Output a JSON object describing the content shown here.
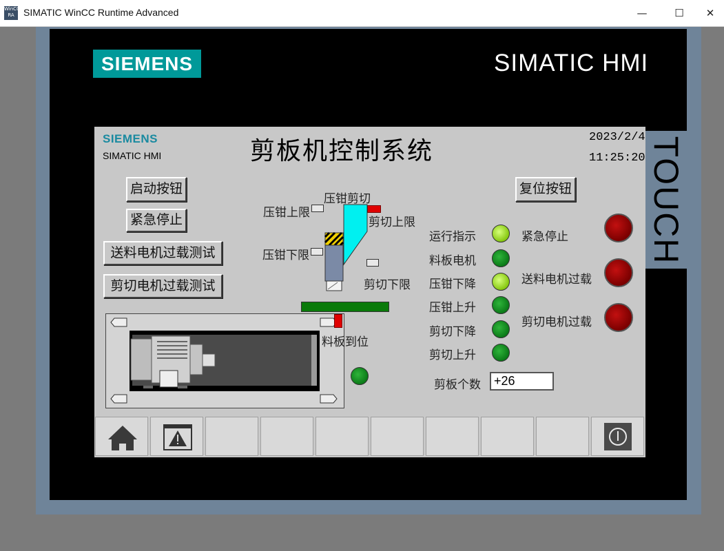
{
  "window": {
    "title": "SIMATIC WinCC Runtime Advanced",
    "icon_text_top": "WinCC",
    "icon_text_bottom": "RA",
    "minimize": "—",
    "maximize": "☐",
    "close": "✕"
  },
  "device": {
    "brand_logo": "SIEMENS",
    "brand_product": "SIMATIC HMI",
    "touch_label": "TOUCH"
  },
  "screen": {
    "logo": "SIEMENS",
    "product": "SIMATIC HMI",
    "title": "剪板机控制系统",
    "date": "2023/2/4",
    "time": "11:25:20",
    "buttons": {
      "start": "启动按钮",
      "estop": "紧急停止",
      "feed_motor_test": "送料电机过载测试",
      "cut_motor_test": "剪切电机过载测试",
      "reset": "复位按钮"
    },
    "labels": {
      "clamp_cut": "压钳剪切",
      "clamp_up_limit": "压钳上限",
      "clamp_down_limit": "压钳下限",
      "cut_up_limit": "剪切上限",
      "cut_down_limit": "剪切下限",
      "plate_in_place": "料板到位",
      "count_label": "剪板个数"
    },
    "indicators": [
      {
        "label": "运行指示",
        "state": "on"
      },
      {
        "label": "料板电机",
        "state": "off"
      },
      {
        "label": "压钳下降",
        "state": "on"
      },
      {
        "label": "压钳上升",
        "state": "off"
      },
      {
        "label": "剪切下降",
        "state": "off"
      },
      {
        "label": "剪切上升",
        "state": "off"
      }
    ],
    "alarms": [
      {
        "label": "紧急停止"
      },
      {
        "label": "送料电机过载"
      },
      {
        "label": "剪切电机过载"
      }
    ],
    "count_value": "+26"
  },
  "colors": {
    "siemens_teal": "#009999",
    "indicator_on": "#a3e01a",
    "indicator_off": "#0f8a1e",
    "alarm_red": "#8a0000",
    "bezel": "#6f8499"
  },
  "function_keys": [
    {
      "icon": "home-icon"
    },
    {
      "icon": "alarm-warning-icon"
    },
    {
      "icon": ""
    },
    {
      "icon": ""
    },
    {
      "icon": ""
    },
    {
      "icon": ""
    },
    {
      "icon": ""
    },
    {
      "icon": ""
    },
    {
      "icon": ""
    },
    {
      "icon": "power-icon"
    }
  ]
}
